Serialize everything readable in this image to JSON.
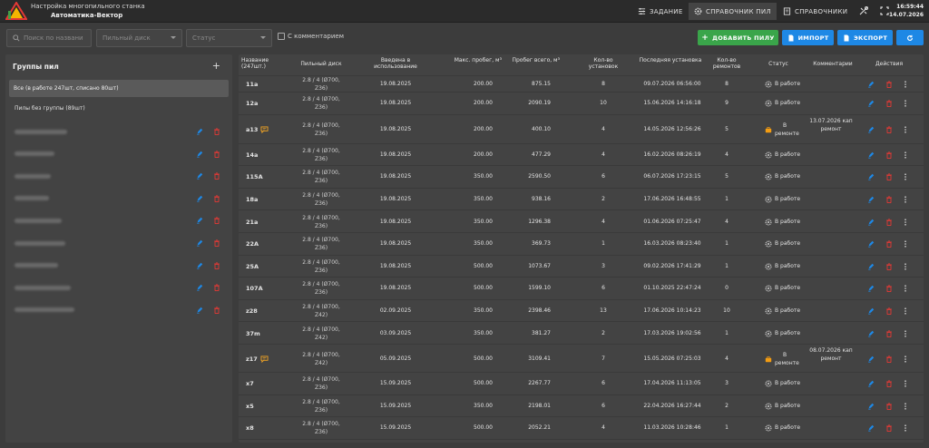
{
  "app": {
    "title_line1": "Настройка многопильного станка",
    "title_line2": "Автоматика-Вектор"
  },
  "nav": [
    {
      "label": "ЗАДАНИЕ",
      "icon": "sliders-icon"
    },
    {
      "label": "СПРАВОЧНИК ПИЛ",
      "icon": "gear-icon",
      "active": true
    },
    {
      "label": "СПРАВОЧНИКИ",
      "icon": "book-icon"
    }
  ],
  "clock": {
    "time": "16:59:44",
    "date": "14.07.2026"
  },
  "filters": {
    "search_placeholder": "Поиск по названи",
    "disc_placeholder": "Пильный диск",
    "status_placeholder": "Статус",
    "comment_checkbox": "С комментарием"
  },
  "actions": {
    "add": "ДОБАВИТЬ ПИЛУ",
    "import": "ИМПОРТ",
    "export": "ЭКСПОРТ"
  },
  "groups": {
    "title": "Группы пил",
    "all": "Все (в работе 247шт, списано 80шт)",
    "no_group": "Пилы без группы (89шт)",
    "count": 9
  },
  "columns": [
    "Название (247шт.)",
    "Пильный диск",
    "Введена в использование",
    "Макс. пробег, м³",
    "Пробег всего, м³",
    "Кол-во установок",
    "Последняя установка",
    "Кол-во ремонтов",
    "Статус",
    "Комментарии",
    "Действия"
  ],
  "rows": [
    {
      "name": "11a",
      "disc1": "2.8 / 4 (Ø700,",
      "disc2": "Z36)",
      "date": "19.08.2025",
      "max": "200.00",
      "total": "875.15",
      "inst": "8",
      "last": "09.07.2026 06:56:00",
      "rep": "8",
      "status": "В работе",
      "comment": ""
    },
    {
      "name": "12a",
      "disc1": "2.8 / 4 (Ø700,",
      "disc2": "Z36)",
      "date": "19.08.2025",
      "max": "200.00",
      "total": "2090.19",
      "inst": "10",
      "last": "15.06.2026 14:16:18",
      "rep": "9",
      "status": "В работе",
      "comment": ""
    },
    {
      "name": "a13",
      "disc1": "2.8 / 4 (Ø700,",
      "disc2": "Z36)",
      "date": "19.08.2025",
      "max": "200.00",
      "total": "400.10",
      "inst": "4",
      "last": "14.05.2026 12:56:26",
      "rep": "5",
      "status": "В ремонте",
      "comment": "13.07.2026 кап ремонт",
      "has_comment": true
    },
    {
      "name": "14a",
      "disc1": "2.8 / 4 (Ø700,",
      "disc2": "Z36)",
      "date": "19.08.2025",
      "max": "200.00",
      "total": "477.29",
      "inst": "4",
      "last": "16.02.2026 08:26:19",
      "rep": "4",
      "status": "В работе",
      "comment": ""
    },
    {
      "name": "115A",
      "disc1": "2.8 / 4 (Ø700,",
      "disc2": "Z36)",
      "date": "19.08.2025",
      "max": "350.00",
      "total": "2590.50",
      "inst": "6",
      "last": "06.07.2026 17:23:15",
      "rep": "5",
      "status": "В работе",
      "comment": ""
    },
    {
      "name": "18a",
      "disc1": "2.8 / 4 (Ø700,",
      "disc2": "Z36)",
      "date": "19.08.2025",
      "max": "350.00",
      "total": "938.16",
      "inst": "2",
      "last": "17.06.2026 16:48:55",
      "rep": "1",
      "status": "В работе",
      "comment": ""
    },
    {
      "name": "21a",
      "disc1": "2.8 / 4 (Ø700,",
      "disc2": "Z36)",
      "date": "19.08.2025",
      "max": "350.00",
      "total": "1296.38",
      "inst": "4",
      "last": "01.06.2026 07:25:47",
      "rep": "4",
      "status": "В работе",
      "comment": ""
    },
    {
      "name": "22A",
      "disc1": "2.8 / 4 (Ø700,",
      "disc2": "Z36)",
      "date": "19.08.2025",
      "max": "350.00",
      "total": "369.73",
      "inst": "1",
      "last": "16.03.2026 08:23:40",
      "rep": "1",
      "status": "В работе",
      "comment": ""
    },
    {
      "name": "25A",
      "disc1": "2.8 / 4 (Ø700,",
      "disc2": "Z36)",
      "date": "19.08.2025",
      "max": "500.00",
      "total": "1073.67",
      "inst": "3",
      "last": "09.02.2026 17:41:29",
      "rep": "1",
      "status": "В работе",
      "comment": ""
    },
    {
      "name": "107A",
      "disc1": "2.8 / 4 (Ø700,",
      "disc2": "Z36)",
      "date": "19.08.2025",
      "max": "500.00",
      "total": "1599.10",
      "inst": "6",
      "last": "01.10.2025 22:47:24",
      "rep": "0",
      "status": "В работе",
      "comment": ""
    },
    {
      "name": "z28",
      "disc1": "2.8 / 4 (Ø700,",
      "disc2": "Z42)",
      "date": "02.09.2025",
      "max": "350.00",
      "total": "2398.46",
      "inst": "13",
      "last": "17.06.2026 10:14:23",
      "rep": "10",
      "status": "В работе",
      "comment": ""
    },
    {
      "name": "37m",
      "disc1": "2.8 / 4 (Ø700,",
      "disc2": "Z42)",
      "date": "03.09.2025",
      "max": "350.00",
      "total": "381.27",
      "inst": "2",
      "last": "17.03.2026 19:02:56",
      "rep": "1",
      "status": "В работе",
      "comment": ""
    },
    {
      "name": "z17",
      "disc1": "2.8 / 4 (Ø700,",
      "disc2": "Z42)",
      "date": "05.09.2025",
      "max": "500.00",
      "total": "3109.41",
      "inst": "7",
      "last": "15.05.2026 07:25:03",
      "rep": "4",
      "status": "В ремонте",
      "comment": "08.07.2026 кап ремонт",
      "has_comment": true
    },
    {
      "name": "x7",
      "disc1": "2.8 / 4 (Ø700,",
      "disc2": "Z36)",
      "date": "15.09.2025",
      "max": "500.00",
      "total": "2267.77",
      "inst": "6",
      "last": "17.04.2026 11:13:05",
      "rep": "3",
      "status": "В работе",
      "comment": ""
    },
    {
      "name": "x5",
      "disc1": "2.8 / 4 (Ø700,",
      "disc2": "Z36)",
      "date": "15.09.2025",
      "max": "350.00",
      "total": "2198.01",
      "inst": "6",
      "last": "22.04.2026 16:27:44",
      "rep": "2",
      "status": "В работе",
      "comment": ""
    },
    {
      "name": "x8",
      "disc1": "2.8 / 4 (Ø700,",
      "disc2": "Z36)",
      "date": "15.09.2025",
      "max": "500.00",
      "total": "2052.21",
      "inst": "4",
      "last": "11.03.2026 10:28:46",
      "rep": "1",
      "status": "В работе",
      "comment": ""
    }
  ]
}
